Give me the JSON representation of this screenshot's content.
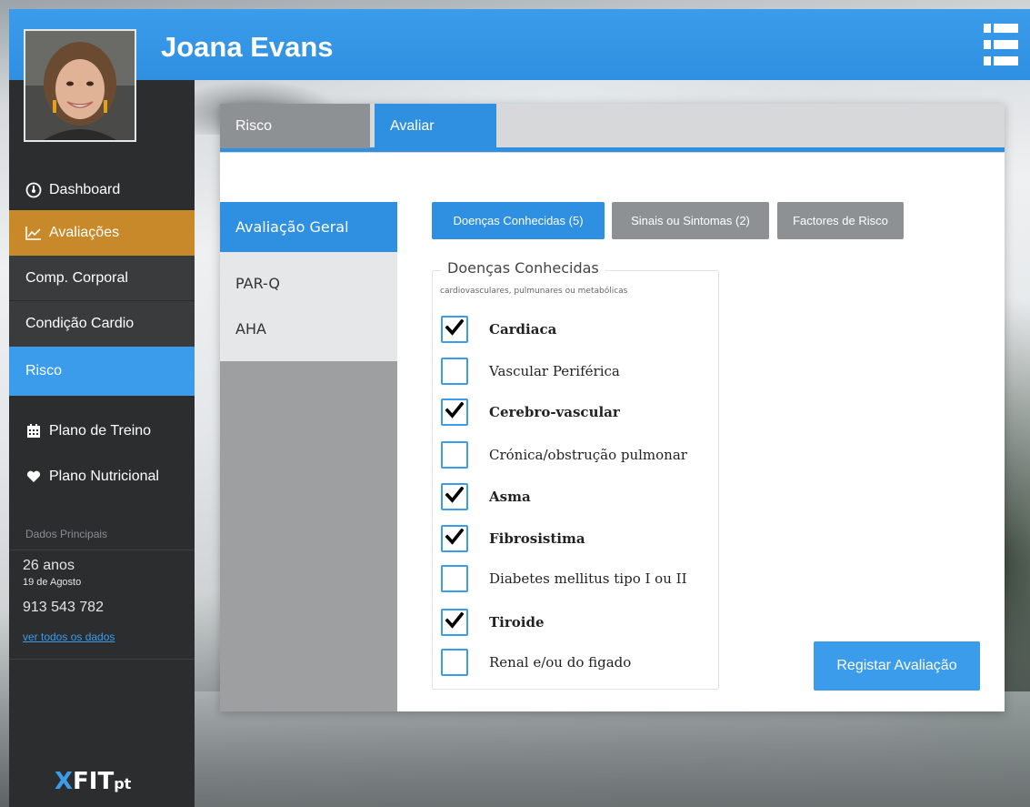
{
  "header": {
    "user_name": "Joana Evans",
    "menu_icon": "list-menu-icon",
    "accent": "#3b9cec"
  },
  "sidebar": {
    "items": [
      {
        "label": "Dashboard",
        "icon": "dashboard-gauge-icon"
      },
      {
        "label": "Avaliações",
        "icon": "line-chart-icon",
        "active_color": "#c8892a"
      },
      {
        "label": "Comp. Corporal"
      },
      {
        "label": "Condição Cardio"
      },
      {
        "label": "Risco",
        "selected_color": "#3b9cec"
      },
      {
        "label": "Plano de Treino",
        "icon": "calendar-icon"
      },
      {
        "label": "Plano Nutricional",
        "icon": "heart-icon"
      }
    ],
    "dados_title": "Dados Principais",
    "age": "26 anos",
    "birthday": "19 de Agosto",
    "phone": "913 543 782",
    "ver_link": "ver todos os dados",
    "logo": {
      "x": "X",
      "fit": "FIT",
      "pt": "pt"
    }
  },
  "tabs": [
    {
      "label": "Risco"
    },
    {
      "label": "Avaliar"
    }
  ],
  "left_menu": [
    {
      "label": "Avaliação Geral"
    },
    {
      "label": "PAR-Q"
    },
    {
      "label": "AHA"
    }
  ],
  "filters": [
    {
      "label": "Doenças Conhecidas (5)"
    },
    {
      "label": "Sinais ou Sintomas (2)"
    },
    {
      "label": "Factores de Risco"
    }
  ],
  "fieldset": {
    "legend": "Doenças Conhecidas",
    "subtitle": "cardiovasculares, pulmunares ou metabólicas",
    "items": [
      {
        "label": "Cardiaca",
        "checked": true
      },
      {
        "label": "Vascular Periférica",
        "checked": false
      },
      {
        "label": "Cerebro-vascular",
        "checked": true
      },
      {
        "label": "Crónica/obstrução pulmonar",
        "checked": false
      },
      {
        "label": "Asma",
        "checked": true
      },
      {
        "label": "Fibrosistima",
        "checked": true
      },
      {
        "label": "Diabetes mellitus tipo I ou II",
        "checked": false
      },
      {
        "label": "Tiroide",
        "checked": true
      },
      {
        "label": "Renal e/ou do figado",
        "checked": false
      }
    ]
  },
  "submit_label": "Registar Avaliação"
}
